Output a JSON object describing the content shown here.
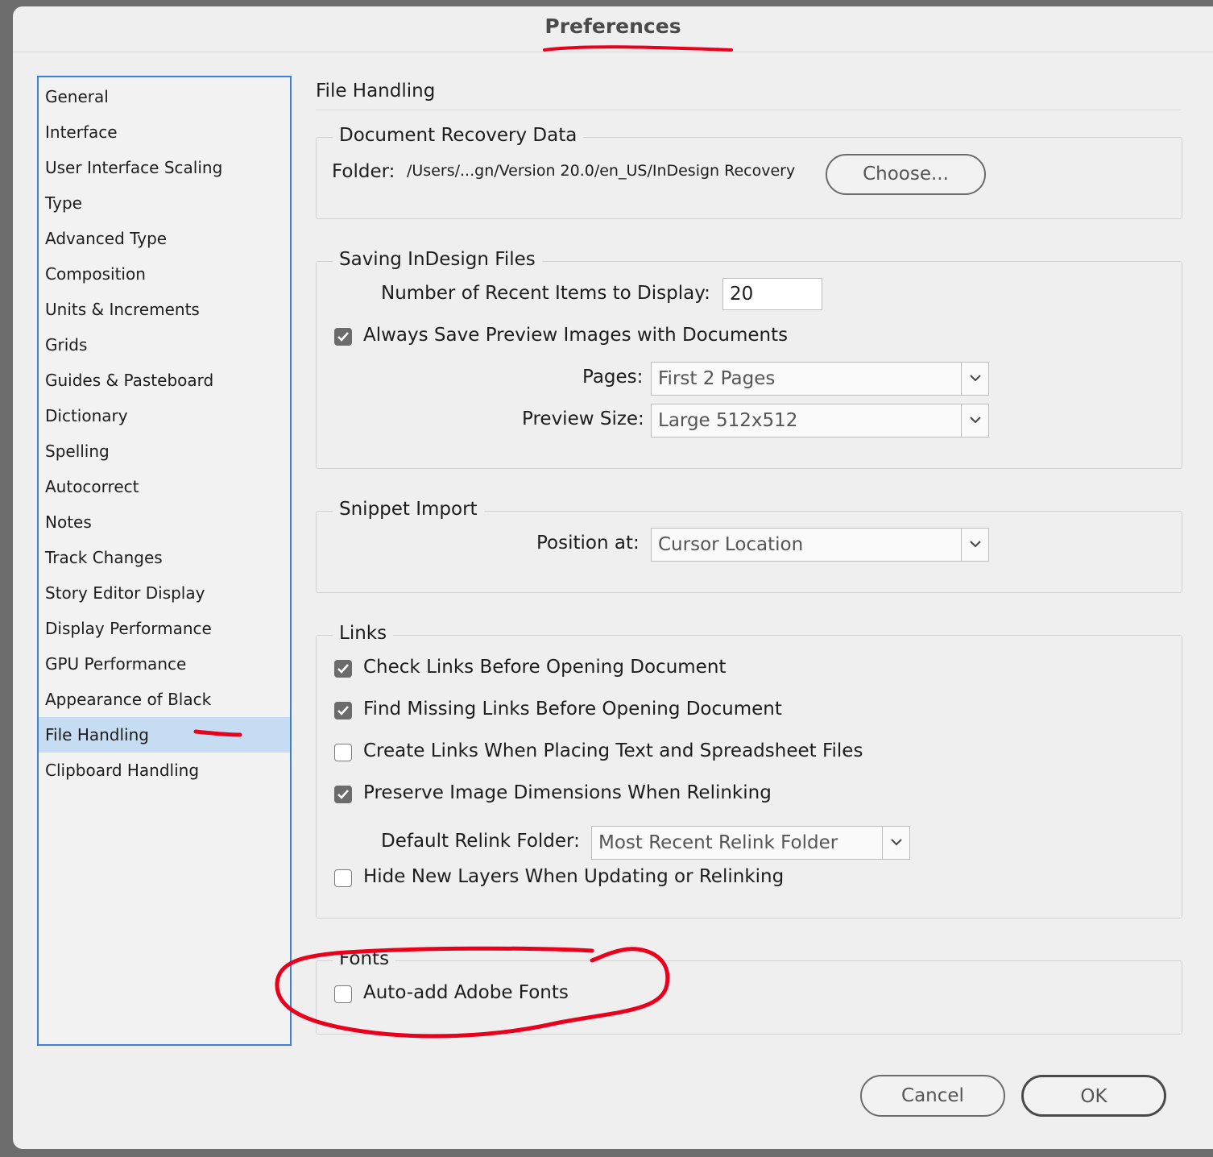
{
  "window": {
    "title": "Preferences"
  },
  "sidebar": {
    "items": [
      {
        "label": "General"
      },
      {
        "label": "Interface"
      },
      {
        "label": "User Interface Scaling"
      },
      {
        "label": "Type"
      },
      {
        "label": "Advanced Type"
      },
      {
        "label": "Composition"
      },
      {
        "label": "Units & Increments"
      },
      {
        "label": "Grids"
      },
      {
        "label": "Guides & Pasteboard"
      },
      {
        "label": "Dictionary"
      },
      {
        "label": "Spelling"
      },
      {
        "label": "Autocorrect"
      },
      {
        "label": "Notes"
      },
      {
        "label": "Track Changes"
      },
      {
        "label": "Story Editor Display"
      },
      {
        "label": "Display Performance"
      },
      {
        "label": "GPU Performance"
      },
      {
        "label": "Appearance of Black"
      },
      {
        "label": "File Handling",
        "selected": true
      },
      {
        "label": "Clipboard Handling"
      }
    ]
  },
  "panel": {
    "title": "File Handling",
    "recovery": {
      "legend": "Document Recovery Data",
      "folder_label": "Folder:",
      "folder_path": "/Users/...gn/Version 20.0/en_US/InDesign Recovery",
      "choose_button": "Choose..."
    },
    "saving": {
      "legend": "Saving InDesign Files",
      "recent_label": "Number of Recent Items to Display:",
      "recent_value": "20",
      "always_save_preview": {
        "label": "Always Save Preview Images with Documents",
        "checked": true
      },
      "pages_label": "Pages:",
      "pages_value": "First 2 Pages",
      "preview_size_label": "Preview Size:",
      "preview_size_value": "Large 512x512"
    },
    "snippet": {
      "legend": "Snippet Import",
      "position_label": "Position at:",
      "position_value": "Cursor Location"
    },
    "links": {
      "legend": "Links",
      "check_links": {
        "label": "Check Links Before Opening Document",
        "checked": true
      },
      "find_missing": {
        "label": "Find Missing Links Before Opening Document",
        "checked": true
      },
      "create_links": {
        "label": "Create Links When Placing Text and Spreadsheet Files",
        "checked": false
      },
      "preserve_dims": {
        "label": "Preserve Image Dimensions When Relinking",
        "checked": true
      },
      "relink_folder_label": "Default Relink Folder:",
      "relink_folder_value": "Most Recent Relink Folder",
      "hide_layers": {
        "label": "Hide New Layers When Updating or Relinking",
        "checked": false
      }
    },
    "fonts": {
      "legend": "Fonts",
      "auto_add": {
        "label": "Auto-add Adobe Fonts",
        "checked": false
      }
    }
  },
  "footer": {
    "cancel": "Cancel",
    "ok": "OK"
  },
  "colors": {
    "selection": "#c6dcf3",
    "sidebar_border": "#3b7fd9",
    "annotation": "#e8001c"
  }
}
